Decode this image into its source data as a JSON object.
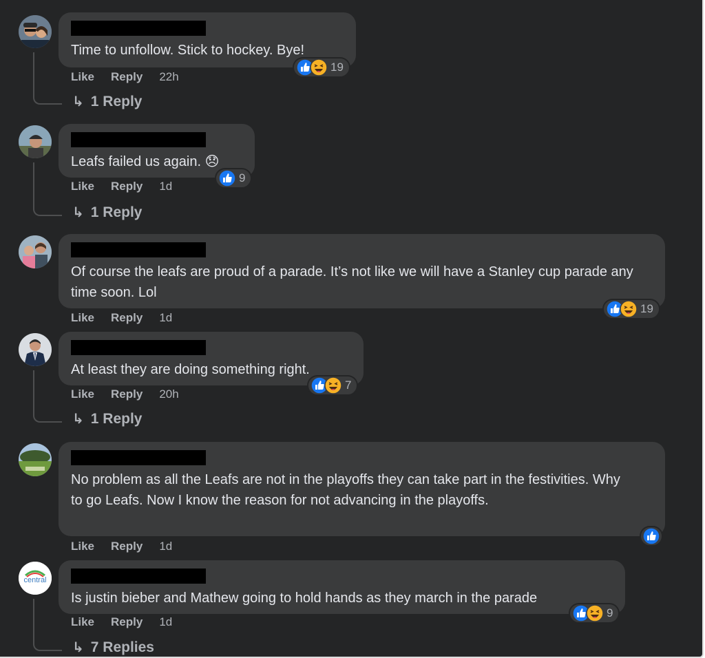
{
  "comments": [
    {
      "text": "Time to unfollow. Stick to hockey. Bye!",
      "actions": {
        "like": "Like",
        "reply": "Reply",
        "time": "22h"
      },
      "reactions": {
        "icons": [
          "like-icon",
          "haha-icon"
        ],
        "count": "19"
      },
      "replies": "1 Reply",
      "avatar": "avatar-couple"
    },
    {
      "text": "Leafs failed us again. 😞",
      "actions": {
        "like": "Like",
        "reply": "Reply",
        "time": "1d"
      },
      "reactions": {
        "icons": [
          "like-icon"
        ],
        "count": "9"
      },
      "replies": "1 Reply",
      "avatar": "avatar-man-cap"
    },
    {
      "text": "Of course the leafs are proud of a parade. It’s not like we will have a Stanley cup parade any time soon. Lol",
      "actions": {
        "like": "Like",
        "reply": "Reply",
        "time": "1d"
      },
      "reactions": {
        "icons": [
          "like-icon",
          "haha-icon"
        ],
        "count": "19"
      },
      "replies": "",
      "avatar": "avatar-family"
    },
    {
      "text": "At least they are doing something right.",
      "actions": {
        "like": "Like",
        "reply": "Reply",
        "time": "20h"
      },
      "reactions": {
        "icons": [
          "like-icon",
          "haha-icon"
        ],
        "count": "7"
      },
      "replies": "1 Reply",
      "avatar": "avatar-suit"
    },
    {
      "text": "No problem as all the Leafs are not in the playoffs they can take part in the festivities. Why to go Leafs. Now I know the reason for not advancing in the playoffs.",
      "actions": {
        "like": "Like",
        "reply": "Reply",
        "time": "1d"
      },
      "reactions": {
        "icons": [
          "like-icon"
        ],
        "count": ""
      },
      "replies": "",
      "avatar": "avatar-landscape"
    },
    {
      "text": "Is justin bieber and Mathew going to hold hands as they march in the parade",
      "actions": {
        "like": "Like",
        "reply": "Reply",
        "time": "1d"
      },
      "reactions": {
        "icons": [
          "like-icon",
          "haha-icon"
        ],
        "count": "9"
      },
      "replies": "7 Replies",
      "avatar": "avatar-logo",
      "avatar_logo_text": "central"
    }
  ],
  "colors": {
    "background": "#242526",
    "bubble": "#3a3b3c",
    "text": "#e4e6eb",
    "secondary": "#b0b3b8",
    "like_blue": "#1877f2",
    "haha_yellow": "#f7b125"
  }
}
